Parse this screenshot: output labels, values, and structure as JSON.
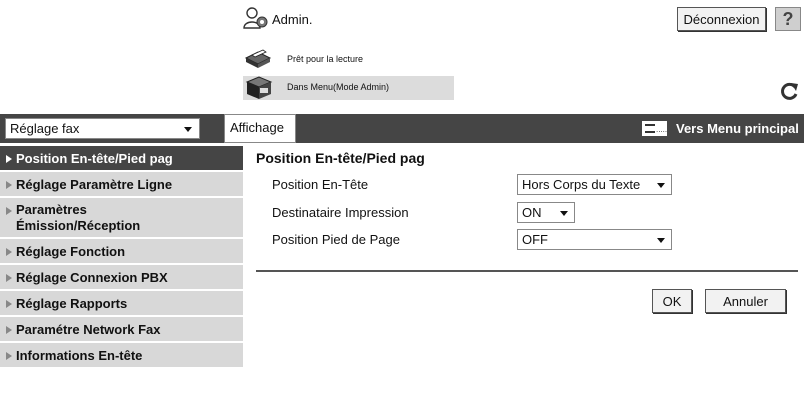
{
  "header": {
    "user_label": "Admin.",
    "logout_label": "Déconnexion",
    "help_glyph": "?"
  },
  "status": {
    "line1": "Prêt pour la lecture",
    "line2": "Dans Menu(Mode Admin)"
  },
  "toolbar": {
    "category_selected": "Réglage fax",
    "display_tab": "Affichage",
    "main_menu_label": "Vers Menu principal",
    "main_menu_icon_dots": "....."
  },
  "sidebar": {
    "items": [
      {
        "label": "Position En-tête/Pied pag",
        "active": true
      },
      {
        "label": "Réglage Paramètre Ligne",
        "active": false
      },
      {
        "label": "Paramètres Émission/Réception",
        "line1": "Paramètres",
        "line2": "Émission/Réception",
        "active": false
      },
      {
        "label": "Réglage Fonction",
        "active": false
      },
      {
        "label": "Réglage Connexion PBX",
        "active": false
      },
      {
        "label": "Réglage Rapports",
        "active": false
      },
      {
        "label": "Paramétre Network Fax",
        "active": false
      },
      {
        "label": "Informations En-tête",
        "active": false
      }
    ]
  },
  "content": {
    "title": "Position En-tête/Pied pag",
    "fields": [
      {
        "label": "Position En-Tête",
        "value": "Hors Corps du Texte"
      },
      {
        "label": "Destinataire Impression",
        "value": "ON"
      },
      {
        "label": "Position Pied de Page",
        "value": "OFF"
      }
    ],
    "ok_label": "OK",
    "cancel_label": "Annuler"
  },
  "colors": {
    "dark_bar": "#454545",
    "sidebar_item": "#d8d8d8",
    "status_highlight": "#dcdcdc"
  }
}
